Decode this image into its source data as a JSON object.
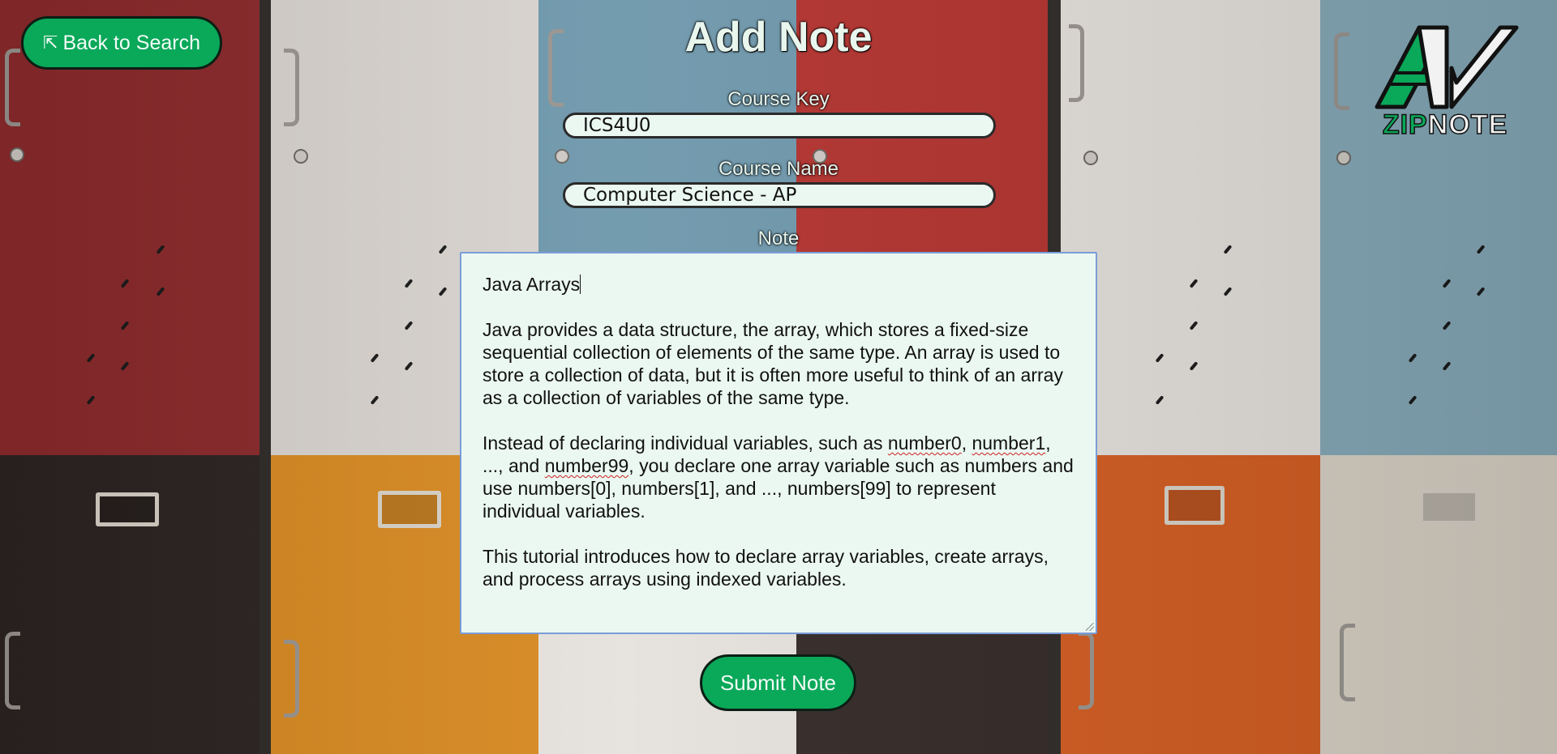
{
  "header": {
    "back_label": "Back to Search",
    "back_icon": "arrow-up-left-icon",
    "title": "Add Note"
  },
  "logo": {
    "zip": "ZIP",
    "note": "NOTE",
    "colors": {
      "accent": "#0aa859",
      "dark": "#111111"
    }
  },
  "form": {
    "course_key_label": "Course Key",
    "course_key_value": "ICS4U0",
    "course_name_label": "Course Name",
    "course_name_value": "Computer Science - AP",
    "note_label": "Note",
    "note_title": "Java Arrays",
    "note_para1": "Java provides a data structure, the array, which stores a fixed-size sequential collection of elements of the same type. An array is used to store a collection of data, but it is often more useful to think of an array as a collection of variables of the same type.",
    "note_para2_a": "Instead of declaring individual variables, such as ",
    "note_para2_w1": "number0",
    "note_para2_b": ", ",
    "note_para2_w2": "number1",
    "note_para2_c": ", ..., and ",
    "note_para2_w3": "number99",
    "note_para2_d": ", you declare one array variable such as numbers and use numbers[0], numbers[1], and ..., numbers[99] to represent individual variables.",
    "note_para3": "This tutorial introduces how to declare array variables, create arrays, and process arrays using indexed variables.",
    "submit_label": "Submit Note"
  },
  "colors": {
    "button_green": "#0aa859",
    "field_bg": "#ebf8f1",
    "note_border": "#7a9cd8"
  }
}
